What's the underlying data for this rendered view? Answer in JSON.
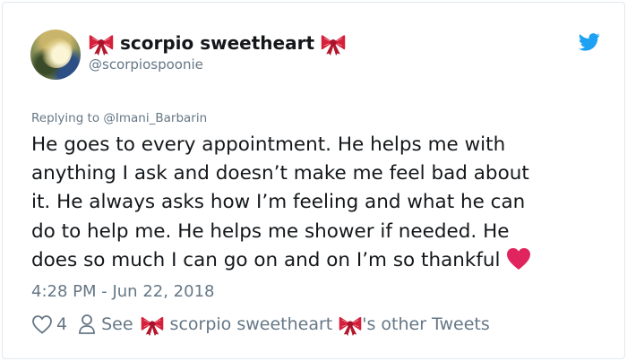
{
  "tweet": {
    "display_name": "scorpio sweetheart",
    "handle": "@scorpiospoonie",
    "reply_prefix": "Replying to",
    "reply_to": "@Imani_Barbarin",
    "text_lines": [
      "He goes to every appointment. He helps me with",
      "anything I ask and doesn’t make me feel bad about",
      "it. He always asks how I’m feeling and what he can",
      "do to help me. He helps me shower if needed. He",
      "does so much I can go on and on I’m so thankful"
    ],
    "timestamp": "4:28 PM - Jun 22, 2018",
    "like_count": "4",
    "see_label": "See",
    "other_tweets_name": "scorpio sweetheart",
    "other_tweets_suffix": "'s other Tweets"
  },
  "icons": {
    "bow": "ribbon-bow-emoji",
    "heart": "red-heart-emoji",
    "logo": "twitter-bird-icon",
    "like": "heart-outline-icon",
    "profile": "person-outline-icon"
  },
  "colors": {
    "text": "#14171a",
    "secondary": "#657786",
    "twitter_blue": "#1da1f2",
    "heart_red": "#e0245e",
    "bow_red": "#d61f3a",
    "border": "#e1e8ed"
  }
}
